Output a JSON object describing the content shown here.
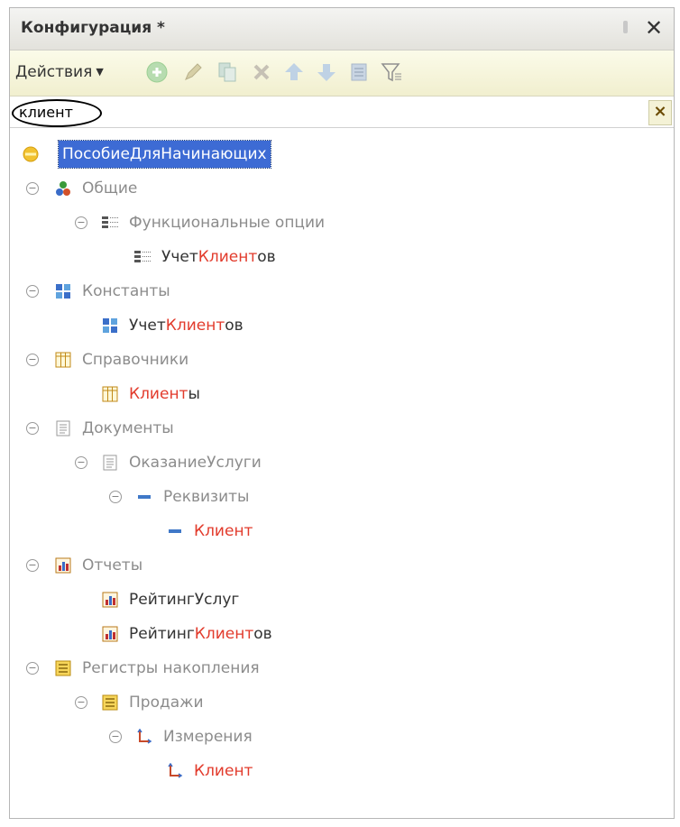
{
  "window": {
    "title": "Конфигурация *"
  },
  "toolbar": {
    "actions_label": "Действия",
    "icons": [
      "add-icon",
      "edit-icon",
      "copy-icon",
      "delete-icon",
      "move-up-icon",
      "move-down-icon",
      "sort-icon",
      "filter-icon"
    ]
  },
  "search": {
    "value": "клиент",
    "clear_label": "×"
  },
  "tree": [
    {
      "pre": "ПособиеДляНачинающих",
      "hit": "",
      "post": "",
      "icon": "config-root-icon",
      "selected": true
    },
    {
      "pre": "Общие",
      "hit": "",
      "post": "",
      "icon": "common-icon"
    },
    {
      "pre": "Функциональные опции",
      "hit": "",
      "post": "",
      "icon": "functional-options-icon"
    },
    {
      "pre": "Учет",
      "hit": "Клиент",
      "post": "ов",
      "icon": "functional-option-icon"
    },
    {
      "pre": "Константы",
      "hit": "",
      "post": "",
      "icon": "constants-icon"
    },
    {
      "pre": "Учет",
      "hit": "Клиент",
      "post": "ов",
      "icon": "constant-icon"
    },
    {
      "pre": "Справочники",
      "hit": "",
      "post": "",
      "icon": "catalogs-icon"
    },
    {
      "pre": "",
      "hit": "Клиент",
      "post": "ы",
      "icon": "catalog-icon"
    },
    {
      "pre": "Документы",
      "hit": "",
      "post": "",
      "icon": "documents-icon"
    },
    {
      "pre": "ОказаниеУслуги",
      "hit": "",
      "post": "",
      "icon": "document-icon"
    },
    {
      "pre": "Реквизиты",
      "hit": "",
      "post": "",
      "icon": "attributes-icon"
    },
    {
      "pre": "",
      "hit": "Клиент",
      "post": "",
      "icon": "attribute-icon"
    },
    {
      "pre": "Отчеты",
      "hit": "",
      "post": "",
      "icon": "reports-icon"
    },
    {
      "pre": "РейтингУслуг",
      "hit": "",
      "post": "",
      "icon": "report-icon"
    },
    {
      "pre": "Рейтинг",
      "hit": "Клиент",
      "post": "ов",
      "icon": "report-icon"
    },
    {
      "pre": "Регистры накопления",
      "hit": "",
      "post": "",
      "icon": "accumulation-registers-icon"
    },
    {
      "pre": "Продажи",
      "hit": "",
      "post": "",
      "icon": "accumulation-register-icon"
    },
    {
      "pre": "Измерения",
      "hit": "",
      "post": "",
      "icon": "dimensions-icon"
    },
    {
      "pre": "",
      "hit": "Клиент",
      "post": "",
      "icon": "dimension-icon"
    }
  ]
}
